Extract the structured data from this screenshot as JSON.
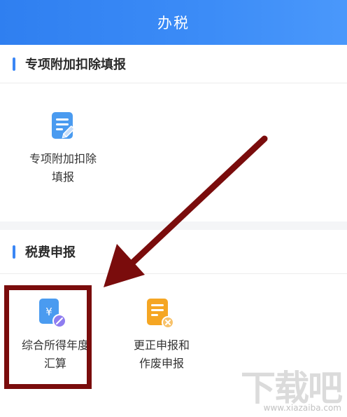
{
  "header": {
    "title": "办税"
  },
  "section_deduction": {
    "title": "专项附加扣除填报",
    "tiles": [
      {
        "label_line1": "专项附加扣除",
        "label_line2": "填报",
        "icon": "edit-form-icon"
      }
    ]
  },
  "section_tax": {
    "title": "税费申报",
    "tiles": [
      {
        "label_line1": "综合所得年度",
        "label_line2": "汇算",
        "icon": "yuan-document-icon"
      },
      {
        "label_line1": "更正申报和",
        "label_line2": "作废申报",
        "icon": "cancel-document-icon"
      }
    ]
  },
  "watermark": {
    "main": "下载吧",
    "sub": "www.xiazaiba.com"
  },
  "colors": {
    "header_blue": "#3c8cf7",
    "icon_blue": "#4a9bf0",
    "icon_orange": "#f5a623",
    "annotation_red": "#7a0c0c"
  }
}
